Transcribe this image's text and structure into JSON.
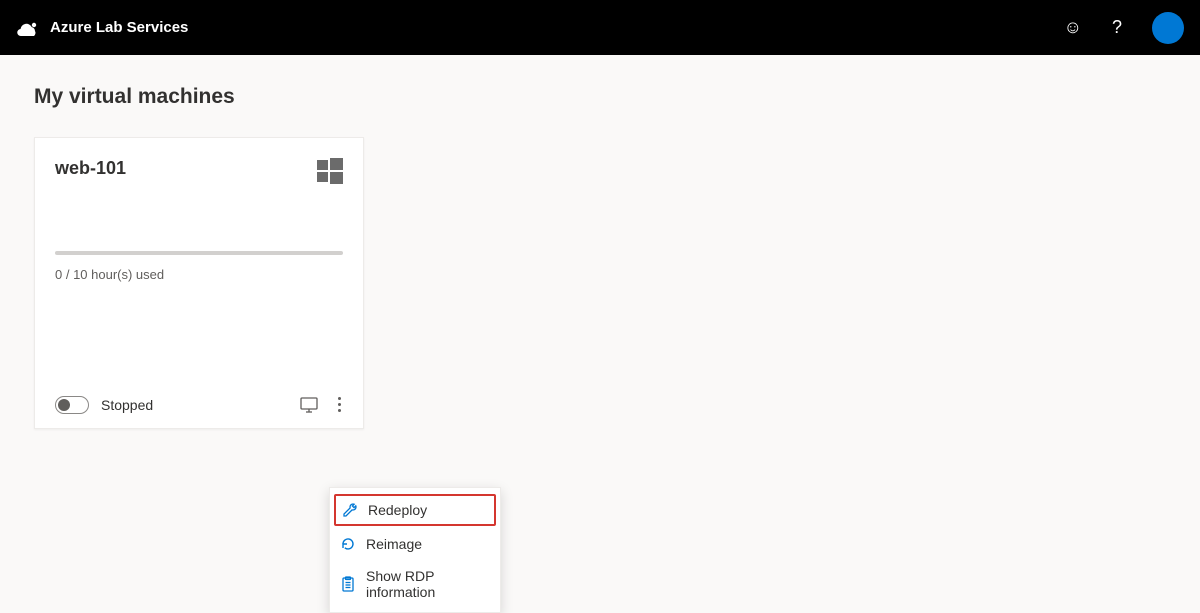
{
  "header": {
    "title": "Azure Lab Services"
  },
  "page": {
    "title": "My virtual machines"
  },
  "vm": {
    "name": "web-101",
    "usage": "0 / 10 hour(s) used",
    "status": "Stopped"
  },
  "menu": {
    "redeploy": "Redeploy",
    "reimage": "Reimage",
    "rdp": "Show RDP information"
  }
}
